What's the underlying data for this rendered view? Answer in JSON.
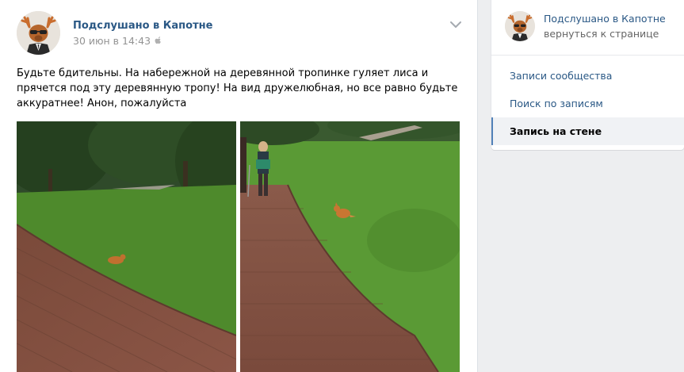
{
  "post": {
    "author": "Подслушано в Капотне",
    "date": "30 июн в 14:43",
    "text": "Будьте бдительны. На набережной на деревянной тропинке гуляет лиса и прячется под эту деревянную тропу! На вид дружелюбная, но все равно будьте аккуратнее! Анон, пожалуйста",
    "photos": [
      {
        "description_icon": "photo-boardwalk-fox-1"
      },
      {
        "description_icon": "photo-boardwalk-fox-2"
      }
    ]
  },
  "sidebar": {
    "group_name": "Подслушано в Капотне",
    "back_link": "вернуться к странице",
    "menu": [
      {
        "label": "Записи сообщества",
        "active": false
      },
      {
        "label": "Поиск по записям",
        "active": false
      },
      {
        "label": "Запись на стене",
        "active": true
      }
    ]
  },
  "colors": {
    "link": "#2a5885",
    "accent": "#5181b8",
    "background": "#edeef0",
    "meta": "#939393"
  }
}
